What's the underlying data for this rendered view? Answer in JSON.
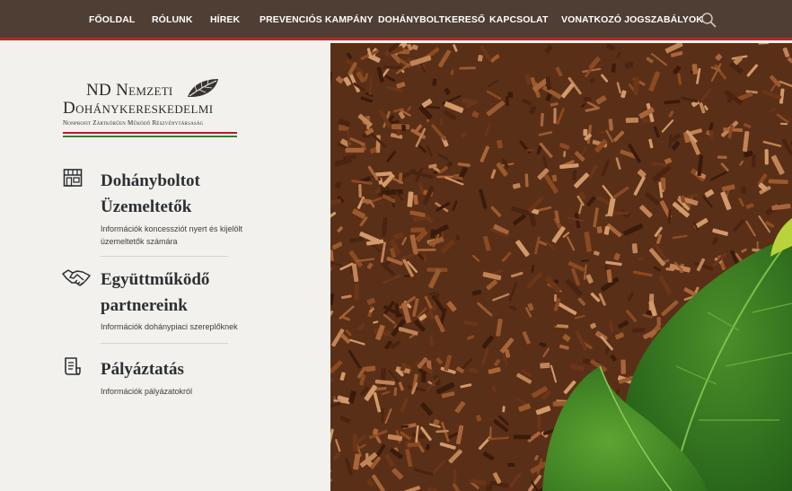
{
  "nav": {
    "items": [
      {
        "label": "FŐOLDAL"
      },
      {
        "label": "RÓLUNK"
      },
      {
        "label": "HÍREK"
      },
      {
        "label": "PREVENCIÓS KAMPÁNY"
      },
      {
        "label": "DOHÁNYBOLTKERESŐ"
      },
      {
        "label": "KAPCSOLAT"
      },
      {
        "label": "VONATKOZÓ JOGSZABÁLYOK"
      }
    ],
    "search_icon": "search-icon"
  },
  "logo": {
    "line1": "ND Nemzeti",
    "line2": "Dohánykereskedelmi",
    "line3": "Nonprofit Zártkörűen Működő Részvénytársaság",
    "icon": "tobacco-leaf-icon",
    "flag_colors": [
      "#c8102e",
      "#ffffff",
      "#2e7d32"
    ]
  },
  "sections": [
    {
      "title": "Dohányboltot Üzemeltetők",
      "desc": "Információk koncessziót nyert és kijelölt üzemeltetők számára",
      "icon": "shop-icon"
    },
    {
      "title": "Együttműködő partnereink",
      "desc": "Információk dohánypiaci szereplőknek",
      "icon": "handshake-icon"
    },
    {
      "title": "Pályáztatás",
      "desc": "Információk pályázatokról",
      "icon": "document-icon"
    }
  ],
  "colors": {
    "nav_bg": "#4f3e33",
    "accent": "#b32a24",
    "panel_bg": "#f3f1ed",
    "heading": "#2c3033"
  }
}
